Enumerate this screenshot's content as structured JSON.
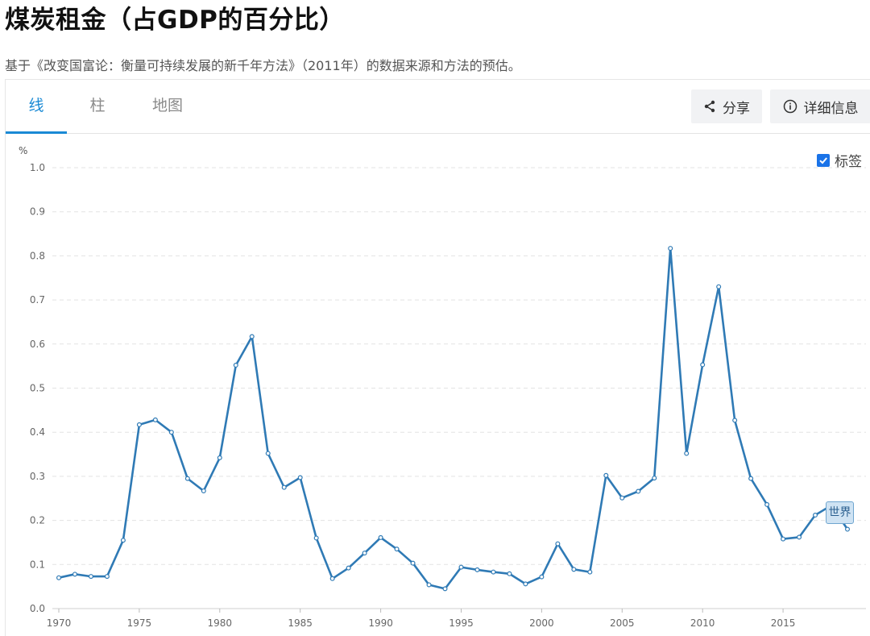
{
  "header": {
    "title": "煤炭租金（占GDP的百分比）",
    "subtitle": "基于《改变国富论：衡量可持续发展的新千年方法》（2011年）的数据来源和方法的预估。"
  },
  "tabs": [
    {
      "label": "线",
      "active": true
    },
    {
      "label": "柱",
      "active": false
    },
    {
      "label": "地图",
      "active": false
    }
  ],
  "toolbar": {
    "share_label": "分享",
    "details_label": "详细信息"
  },
  "legend": {
    "label": "标签",
    "checked": true
  },
  "colors": {
    "line": "#2f7ab5",
    "accent": "#1a8ad5",
    "checkbox": "#1a73e8"
  },
  "chart_data": {
    "type": "line",
    "title": "",
    "xlabel": "",
    "ylabel": "%",
    "ylim": [
      0,
      1.0
    ],
    "xlim": [
      1970,
      2019
    ],
    "grid": true,
    "y_ticks": [
      "0.0",
      "0.1",
      "0.2",
      "0.3",
      "0.4",
      "0.5",
      "0.6",
      "0.7",
      "0.8",
      "0.9",
      "1.0"
    ],
    "x_ticks": [
      "1970",
      "1975",
      "1980",
      "1985",
      "1990",
      "1995",
      "2000",
      "2005",
      "2010",
      "2015"
    ],
    "series": [
      {
        "name": "世界",
        "x": [
          1970,
          1971,
          1972,
          1973,
          1974,
          1975,
          1976,
          1977,
          1978,
          1979,
          1980,
          1981,
          1982,
          1983,
          1984,
          1985,
          1986,
          1987,
          1988,
          1989,
          1990,
          1991,
          1992,
          1993,
          1994,
          1995,
          1996,
          1997,
          1998,
          1999,
          2000,
          2001,
          2002,
          2003,
          2004,
          2005,
          2006,
          2007,
          2008,
          2009,
          2010,
          2011,
          2012,
          2013,
          2014,
          2015,
          2016,
          2017,
          2018,
          2019
        ],
        "values": [
          0.07,
          0.078,
          0.073,
          0.073,
          0.155,
          0.417,
          0.428,
          0.4,
          0.295,
          0.267,
          0.342,
          0.552,
          0.617,
          0.352,
          0.275,
          0.297,
          0.16,
          0.068,
          0.092,
          0.126,
          0.161,
          0.135,
          0.103,
          0.054,
          0.045,
          0.094,
          0.088,
          0.083,
          0.079,
          0.056,
          0.072,
          0.147,
          0.089,
          0.083,
          0.302,
          0.251,
          0.266,
          0.296,
          0.817,
          0.352,
          0.553,
          0.73,
          0.427,
          0.295,
          0.236,
          0.158,
          0.162,
          0.212,
          0.234,
          0.18
        ]
      }
    ]
  }
}
